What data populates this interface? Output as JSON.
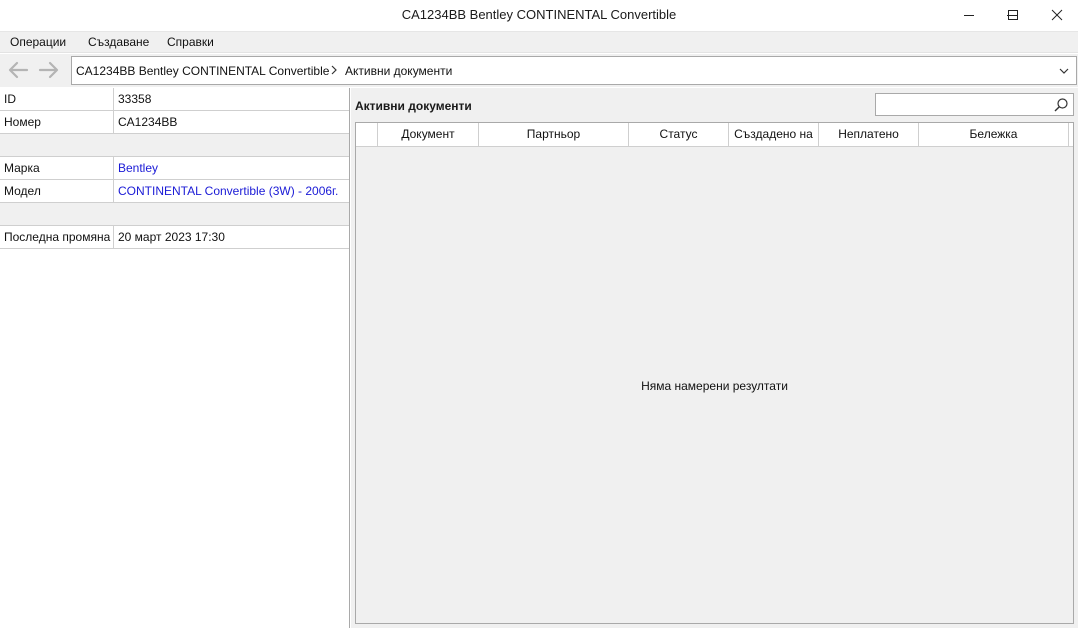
{
  "window": {
    "title": "CA1234BB Bentley CONTINENTAL Convertible"
  },
  "menu": [
    "Операции",
    "Създаване",
    "Справки"
  ],
  "address": {
    "crumbs": [
      "CA1234BB Bentley CONTINENTAL Convertible",
      "Активни документи"
    ]
  },
  "properties": [
    {
      "name": "ID",
      "value": "33358",
      "link": false
    },
    {
      "name": "Номер",
      "value": "CA1234BB",
      "link": false
    },
    {
      "name": "",
      "value": "",
      "blank": true
    },
    {
      "name": "Марка",
      "value": "Bentley",
      "link": true
    },
    {
      "name": "Модел",
      "value": "CONTINENTAL Convertible (3W) - 2006г.",
      "link": true
    },
    {
      "name": "",
      "value": "",
      "blank": true
    },
    {
      "name": "Последна промяна",
      "value": "20 март 2023 17:30",
      "link": false
    }
  ],
  "documents": {
    "title": "Активни документи",
    "search_value": "",
    "columns": [
      "",
      "Документ",
      "Партньор",
      "Статус",
      "Създадено на",
      "Неплатено",
      "Бележка"
    ],
    "rows": [],
    "empty_message": "Няма намерени резултати"
  },
  "icons": {
    "back": "arrow-left-icon",
    "forward": "arrow-right-icon",
    "separator": "chevron-right-icon",
    "dropdown": "chevron-down-icon",
    "search": "search-icon",
    "minimize": "minimize-icon",
    "maximize": "maximize-icon",
    "close": "close-icon"
  },
  "colors": {
    "link": "#1a1ad6",
    "chrome": "#f0f0f0",
    "border": "#a9a9a9"
  }
}
